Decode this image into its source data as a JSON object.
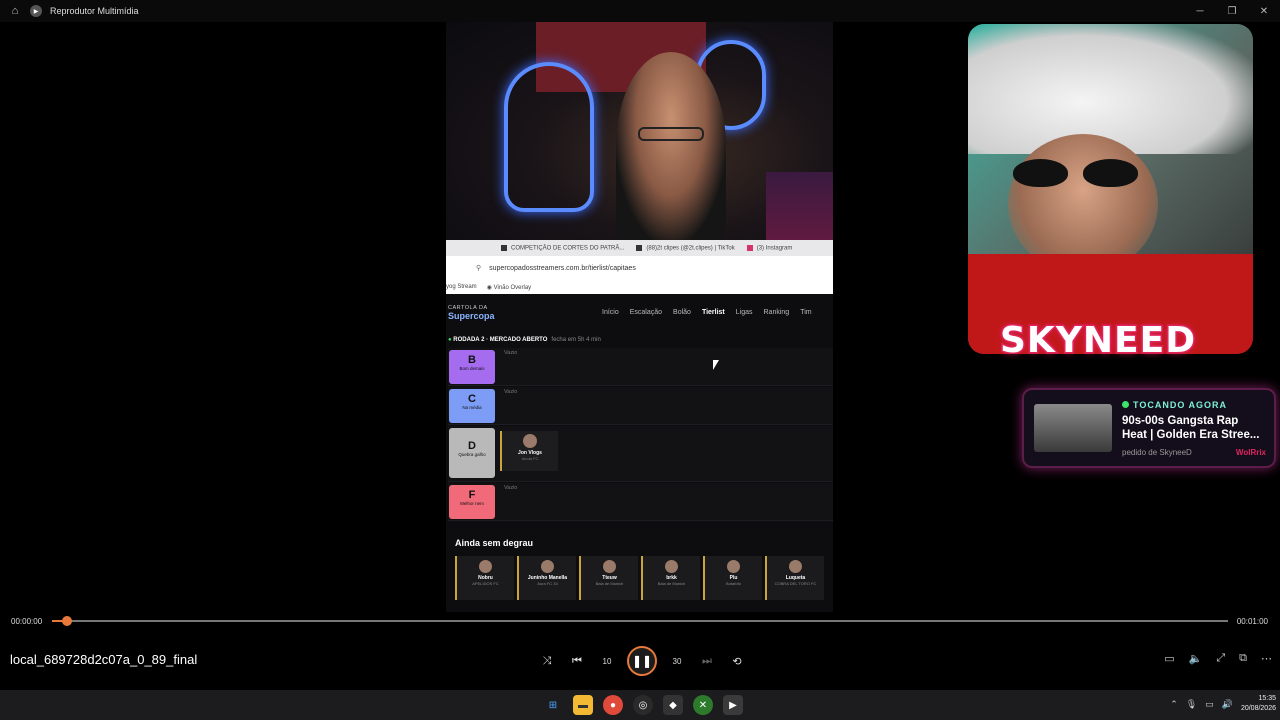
{
  "window": {
    "title": "Reprodutor Multimídia"
  },
  "stream": {
    "browser_tabs": [
      "COMPETIÇÃO DE CORTES DO PATRÃ...",
      "(88)2t clipes (@2t.clipes) | TikTok",
      "(3) Instagram"
    ],
    "url": "supercopadosstreamers.com.br/tierlist/capitaes",
    "bookmarks": [
      "yog Stream",
      "Vinão Overlay"
    ],
    "site": {
      "logo_small": "CARTOLA DA",
      "logo_big": "Supercopa",
      "nav": [
        "Início",
        "Escalação",
        "Bolão",
        "Tierlist",
        "Ligas",
        "Ranking",
        "Tim"
      ],
      "round_label": "RODADA 2 · MERCADO ABERTO",
      "round_time": "fecha em 5h  4 min",
      "tiers": [
        {
          "letter": "B",
          "sub": "Bom demais",
          "empty": "Vazio",
          "color": "#a56cf0"
        },
        {
          "letter": "C",
          "sub": "Na média",
          "empty": "Vazio",
          "color": "#7c9cf5"
        },
        {
          "letter": "D",
          "sub": "Quebra galho",
          "empty": "",
          "color": "#b9b9b9"
        },
        {
          "letter": "F",
          "sub": "Melhor nem",
          "empty": "Vazio",
          "color": "#f06a7a"
        }
      ],
      "tier_d_card": {
        "name": "Jon Vlogs",
        "club": "Ainda FC"
      },
      "unranked_title": "Ainda sem degrau",
      "players": [
        {
          "name": "Nobru",
          "club": "APELIDOS FC"
        },
        {
          "name": "Juninho Manella",
          "club": "Aura FC 33"
        },
        {
          "name": "Tteuw",
          "club": "Bala de Munich"
        },
        {
          "name": "brkk",
          "club": "Bala de Munich"
        },
        {
          "name": "Plu",
          "club": "Botafofo"
        },
        {
          "name": "Luqueta",
          "club": "COBRA DEL TORO FC"
        }
      ]
    }
  },
  "overlay": {
    "name": "SKYNEED",
    "now_playing_label": "TOCANDO AGORA",
    "song_title_1": "90s-00s Gangsta Rap",
    "song_title_2": "Heat | Golden Era Stree...",
    "requested_by": "pedido de SkyneeD",
    "brand": "WolRrix"
  },
  "player": {
    "time_current": "00:00:00",
    "time_total": "00:01:00",
    "progress": 0.013,
    "filename": "local_689728d2c07a_0_89_final",
    "skip_back_label": "10",
    "skip_fwd_label": "30",
    "accent": "#e8793a"
  },
  "taskbar": {
    "time": "15:35",
    "date": "20/08/2026"
  }
}
